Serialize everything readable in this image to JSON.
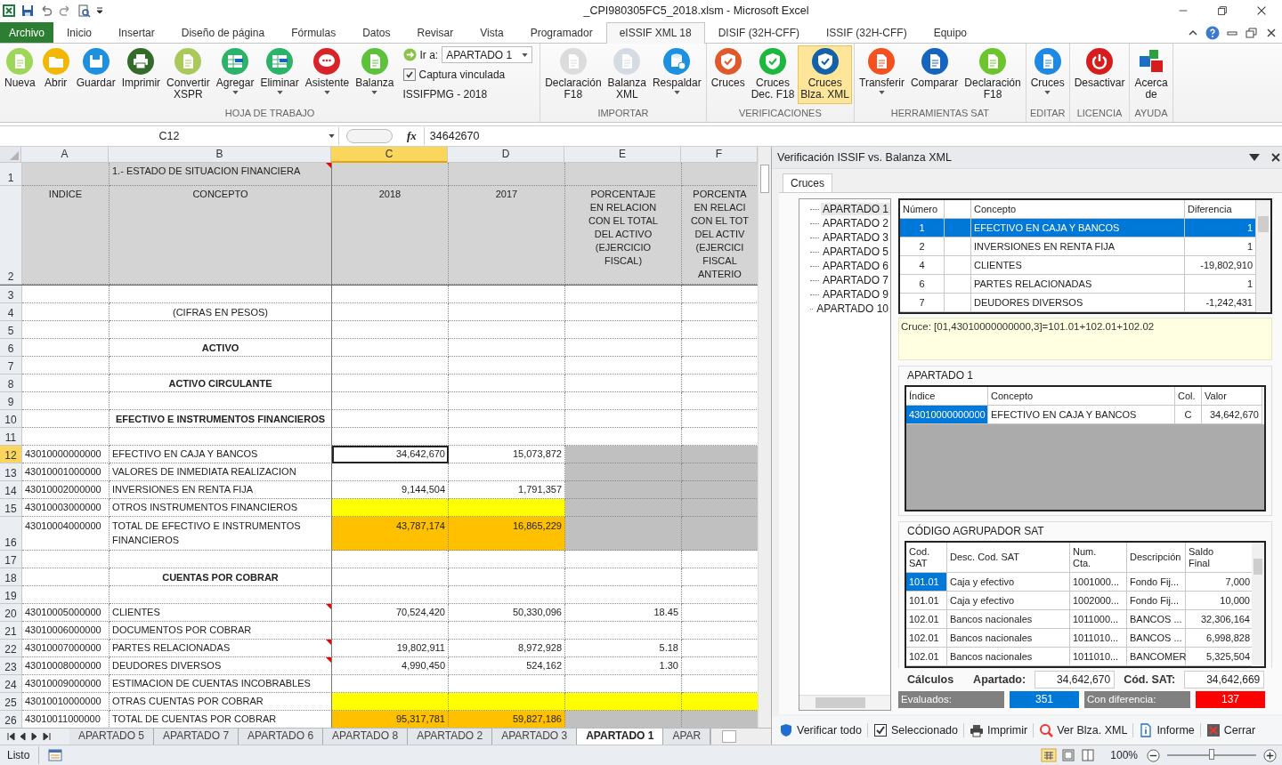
{
  "window": {
    "title": "_CPI980305FC5_2018.xlsm  -  Microsoft Excel"
  },
  "ribbon_tabs": [
    {
      "label": "Archivo",
      "kind": "file",
      "selected": false
    },
    {
      "label": "Inicio",
      "kind": "tab",
      "selected": false
    },
    {
      "label": "Insertar",
      "kind": "tab",
      "selected": false
    },
    {
      "label": "Diseño de página",
      "kind": "tab",
      "selected": false
    },
    {
      "label": "Fórmulas",
      "kind": "tab",
      "selected": false
    },
    {
      "label": "Datos",
      "kind": "tab",
      "selected": false
    },
    {
      "label": "Revisar",
      "kind": "tab",
      "selected": false
    },
    {
      "label": "Vista",
      "kind": "tab",
      "selected": false
    },
    {
      "label": "Programador",
      "kind": "tab",
      "selected": false
    },
    {
      "label": "eISSIF XML 18",
      "kind": "tab",
      "selected": true
    },
    {
      "label": "DISIF (32H-CFF)",
      "kind": "tab",
      "selected": false
    },
    {
      "label": "ISSIF (32H-CFF)",
      "kind": "tab",
      "selected": false
    },
    {
      "label": "Equipo",
      "kind": "tab",
      "selected": false
    }
  ],
  "ribbon": {
    "groups": [
      {
        "label": "HOJA DE TRABAJO",
        "items": [
          {
            "label": "Nueva",
            "kind": "page",
            "color": "#9ed65a",
            "dropdown": false,
            "selected": false
          },
          {
            "label": "Abrir",
            "kind": "folder",
            "color": "#f2b705",
            "dropdown": false,
            "selected": false
          },
          {
            "label": "Guardar",
            "kind": "disk",
            "color": "#1e90e0",
            "dropdown": false,
            "selected": false
          },
          {
            "label": "Imprimir",
            "kind": "printer",
            "color": "#356b2a",
            "dropdown": false,
            "selected": false
          },
          {
            "label": "Convertir\nXSPR",
            "kind": "page",
            "color": "#a9c95b",
            "dropdown": false,
            "selected": false
          },
          {
            "label": "Agregar",
            "kind": "grid",
            "color": "#2bb36a",
            "dropdown": true,
            "selected": false
          },
          {
            "label": "Eliminar",
            "kind": "grid",
            "color": "#2bb36a",
            "dropdown": true,
            "selected": false
          },
          {
            "label": "Asistente",
            "kind": "chat",
            "color": "#d8232a",
            "dropdown": true,
            "selected": false
          },
          {
            "label": "Balanza",
            "kind": "page",
            "color": "#5cc23c",
            "dropdown": true,
            "selected": false
          }
        ],
        "controls": {
          "goto_label": "Ir a:",
          "goto_value": "APARTADO 1",
          "checkbox_label": "Captura vinculada",
          "checked": true,
          "note": "ISSIFPMG - 2018"
        }
      },
      {
        "label": "IMPORTAR",
        "items": [
          {
            "label": "Declaración\nF18",
            "kind": "page",
            "color": "#dcdcdc",
            "dropdown": false,
            "selected": false
          },
          {
            "label": "Balanza\nXML",
            "kind": "page",
            "color": "#d4dbe3",
            "dropdown": false,
            "selected": false
          },
          {
            "label": "Respaldar",
            "kind": "db",
            "color": "#1e90e0",
            "dropdown": true,
            "selected": false
          }
        ]
      },
      {
        "label": "VERIFICACIONES",
        "items": [
          {
            "label": "Cruces",
            "kind": "shield",
            "color": "#e0592b",
            "dropdown": false,
            "selected": false
          },
          {
            "label": "Cruces\nDec. F18",
            "kind": "shield",
            "color": "#1cb83e",
            "dropdown": false,
            "selected": false
          },
          {
            "label": "Cruces\nBlza. XML",
            "kind": "shield",
            "color": "#1461a8",
            "dropdown": false,
            "selected": true
          }
        ]
      },
      {
        "label": "HERRAMIENTAS SAT",
        "items": [
          {
            "label": "Transferir",
            "kind": "page",
            "color": "#f4511e",
            "dropdown": true,
            "selected": false
          },
          {
            "label": "Comparar",
            "kind": "page",
            "color": "#1565c0",
            "dropdown": false,
            "selected": false
          },
          {
            "label": "Declaración\nF18",
            "kind": "page",
            "color": "#6cc52b",
            "dropdown": false,
            "selected": false
          }
        ]
      },
      {
        "label": "EDITAR",
        "items": [
          {
            "label": "Cruces",
            "kind": "page",
            "color": "#1e88e5",
            "dropdown": true,
            "selected": false
          }
        ]
      },
      {
        "label": "LICENCIA",
        "items": [
          {
            "label": "Desactivar",
            "kind": "power",
            "color": "#d81b1b",
            "dropdown": false,
            "selected": false
          }
        ]
      },
      {
        "label": "AYUDA",
        "items": [
          {
            "label": "Acerca\nde",
            "kind": "blocks",
            "dropdown": false,
            "selected": false
          }
        ]
      }
    ]
  },
  "formula_bar": {
    "name_box": "C12",
    "function_symbol": "fx",
    "value": "34642670"
  },
  "sheet": {
    "columns": [
      {
        "label": "A",
        "selected": false
      },
      {
        "label": "B",
        "selected": false
      },
      {
        "label": "C",
        "selected": true
      },
      {
        "label": "D",
        "selected": false
      },
      {
        "label": "E",
        "selected": false
      },
      {
        "label": "F",
        "selected": false
      }
    ],
    "rows": [
      {
        "n": "1",
        "kind": "title",
        "cells": [
          {
            "color": "#d4d4d4"
          },
          {
            "text": "1.- ESTADO DE SITUACION FINANCIERA",
            "color": "#d4d4d4",
            "comment": true
          },
          {
            "color": "#d4d4d4"
          },
          {
            "color": "#d4d4d4"
          },
          {
            "color": "#d4d4d4"
          },
          {
            "color": "#d4d4d4"
          }
        ]
      },
      {
        "n": "2",
        "kind": "header",
        "cells": [
          {
            "text": "INDICE",
            "color": "#d4d4d4"
          },
          {
            "text": "CONCEPTO",
            "color": "#d4d4d4"
          },
          {
            "text": "2018",
            "color": "#d4d4d4"
          },
          {
            "text": "2017",
            "color": "#d4d4d4"
          },
          {
            "text": "PORCENTAJE\nEN RELACION\nCON EL TOTAL\nDEL ACTIVO\n(EJERCICIO\nFISCAL)",
            "color": "#d4d4d4"
          },
          {
            "text": "PORCENTA\nEN RELACI\nCON EL TOT\nDEL ACTIV\n(EJERCICI\nFISCAL\nANTERIO",
            "color": "#d4d4d4"
          }
        ]
      },
      {
        "n": "3",
        "kind": "data",
        "cells": [
          {},
          {},
          {},
          {},
          {},
          {}
        ]
      },
      {
        "n": "4",
        "kind": "note",
        "cells": [
          {},
          {
            "text": "(CIFRAS EN PESOS)"
          },
          {},
          {},
          {},
          {}
        ]
      },
      {
        "n": "5",
        "kind": "data",
        "cells": [
          {},
          {},
          {},
          {},
          {},
          {}
        ]
      },
      {
        "n": "6",
        "kind": "heading",
        "cells": [
          {},
          {
            "text": "ACTIVO"
          },
          {},
          {},
          {},
          {}
        ]
      },
      {
        "n": "7",
        "kind": "data",
        "cells": [
          {},
          {},
          {},
          {},
          {},
          {}
        ]
      },
      {
        "n": "8",
        "kind": "heading",
        "cells": [
          {},
          {
            "text": "ACTIVO CIRCULANTE"
          },
          {},
          {},
          {},
          {}
        ]
      },
      {
        "n": "9",
        "kind": "data",
        "cells": [
          {},
          {},
          {},
          {},
          {},
          {}
        ]
      },
      {
        "n": "10",
        "kind": "heading",
        "cells": [
          {},
          {
            "text": "EFECTIVO E INSTRUMENTOS FINANCIEROS"
          },
          {},
          {},
          {},
          {}
        ]
      },
      {
        "n": "11",
        "kind": "data",
        "cells": [
          {},
          {},
          {},
          {},
          {},
          {}
        ]
      },
      {
        "n": "12",
        "kind": "data",
        "cells": [
          {
            "text": "43010000000000"
          },
          {
            "text": "EFECTIVO EN CAJA Y BANCOS"
          },
          {
            "text": "34,642,670",
            "active": true
          },
          {
            "text": "15,073,872"
          },
          {
            "color": "#c0c0c0"
          },
          {
            "color": "#c0c0c0"
          }
        ]
      },
      {
        "n": "13",
        "kind": "data",
        "cells": [
          {
            "text": "43010001000000"
          },
          {
            "text": "VALORES DE INMEDIATA REALIZACION"
          },
          {},
          {},
          {
            "color": "#c0c0c0"
          },
          {
            "color": "#c0c0c0"
          }
        ]
      },
      {
        "n": "14",
        "kind": "data",
        "cells": [
          {
            "text": "43010002000000"
          },
          {
            "text": "INVERSIONES EN RENTA FIJA"
          },
          {
            "text": "9,144,504"
          },
          {
            "text": "1,791,357"
          },
          {
            "color": "#c0c0c0"
          },
          {
            "color": "#c0c0c0"
          }
        ]
      },
      {
        "n": "15",
        "kind": "data",
        "cells": [
          {
            "text": "43010003000000"
          },
          {
            "text": "OTROS INSTRUMENTOS FINANCIEROS"
          },
          {
            "color": "#ffff00"
          },
          {
            "color": "#ffff00"
          },
          {
            "color": "#c0c0c0"
          },
          {
            "color": "#c0c0c0"
          }
        ]
      },
      {
        "n": "16",
        "kind": "tall",
        "cells": [
          {
            "text": "43010004000000"
          },
          {
            "text": "TOTAL DE EFECTIVO E INSTRUMENTOS FINANCIEROS"
          },
          {
            "text": "43,787,174",
            "color": "#ffc000"
          },
          {
            "text": "16,865,229",
            "color": "#ffc000"
          },
          {
            "color": "#c0c0c0"
          },
          {
            "color": "#c0c0c0"
          }
        ]
      },
      {
        "n": "17",
        "kind": "data",
        "cells": [
          {},
          {},
          {},
          {},
          {},
          {}
        ]
      },
      {
        "n": "18",
        "kind": "heading",
        "cells": [
          {},
          {
            "text": "CUENTAS POR COBRAR"
          },
          {},
          {},
          {},
          {}
        ]
      },
      {
        "n": "19",
        "kind": "data",
        "cells": [
          {},
          {},
          {},
          {},
          {},
          {}
        ]
      },
      {
        "n": "20",
        "kind": "data",
        "cells": [
          {
            "text": "43010005000000"
          },
          {
            "text": "CLIENTES",
            "comment": true
          },
          {
            "text": "70,524,420"
          },
          {
            "text": "50,330,096"
          },
          {
            "text": "18.45"
          },
          {}
        ]
      },
      {
        "n": "21",
        "kind": "data",
        "cells": [
          {
            "text": "43010006000000"
          },
          {
            "text": "DOCUMENTOS POR COBRAR"
          },
          {},
          {},
          {},
          {}
        ]
      },
      {
        "n": "22",
        "kind": "data",
        "cells": [
          {
            "text": "43010007000000"
          },
          {
            "text": "PARTES RELACIONADAS",
            "comment": true
          },
          {
            "text": "19,802,911"
          },
          {
            "text": "8,972,928"
          },
          {
            "text": "5.18"
          },
          {}
        ]
      },
      {
        "n": "23",
        "kind": "data",
        "cells": [
          {
            "text": "43010008000000"
          },
          {
            "text": "DEUDORES DIVERSOS",
            "comment": true
          },
          {
            "text": "4,990,450"
          },
          {
            "text": "524,162"
          },
          {
            "text": "1.30"
          },
          {}
        ]
      },
      {
        "n": "24",
        "kind": "data",
        "cells": [
          {
            "text": "43010009000000"
          },
          {
            "text": "ESTIMACION DE CUENTAS INCOBRABLES"
          },
          {},
          {},
          {},
          {}
        ]
      },
      {
        "n": "25",
        "kind": "data",
        "cells": [
          {
            "text": "43010010000000"
          },
          {
            "text": "OTRAS CUENTAS POR COBRAR"
          },
          {
            "color": "#ffff00"
          },
          {
            "color": "#ffff00"
          },
          {
            "color": "#ffff00"
          },
          {
            "color": "#ffff00"
          }
        ]
      },
      {
        "n": "26",
        "kind": "data",
        "cells": [
          {
            "text": "43010011000000"
          },
          {
            "text": "TOTAL DE CUENTAS POR COBRAR"
          },
          {
            "text": "95,317,781",
            "color": "#ffc000"
          },
          {
            "text": "59,827,186",
            "color": "#ffc000"
          },
          {
            "color": "#c0c0c0"
          },
          {
            "color": "#c0c0c0"
          }
        ]
      }
    ],
    "tabs": [
      {
        "label": "APARTADO 5",
        "selected": false
      },
      {
        "label": "APARTADO 7",
        "selected": false
      },
      {
        "label": "APARTADO 6",
        "selected": false
      },
      {
        "label": "APARTADO 8",
        "selected": false
      },
      {
        "label": "APARTADO 2",
        "selected": false
      },
      {
        "label": "APARTADO 3",
        "selected": false
      },
      {
        "label": "APARTADO 1",
        "selected": true
      },
      {
        "label": "APAR",
        "selected": false
      }
    ]
  },
  "task_pane": {
    "title": "Verificación ISSIF vs. Balanza XML",
    "tabs": [
      {
        "label": "Cruces",
        "selected": true
      }
    ],
    "tree": [
      {
        "label": "APARTADO 1",
        "selected": true
      },
      {
        "label": "APARTADO 2",
        "selected": false
      },
      {
        "label": "APARTADO 3",
        "selected": false
      },
      {
        "label": "APARTADO 5",
        "selected": false
      },
      {
        "label": "APARTADO 6",
        "selected": false
      },
      {
        "label": "APARTADO 7",
        "selected": false
      },
      {
        "label": "APARTADO 9",
        "selected": false
      },
      {
        "label": "APARTADO 10",
        "selected": false
      }
    ],
    "checks": {
      "columns": [
        "Número",
        "Concepto",
        "Diferencia"
      ],
      "rows": [
        {
          "number": "1",
          "concept": "EFECTIVO EN CAJA Y BANCOS",
          "difference": "1",
          "selected": true
        },
        {
          "number": "2",
          "concept": "INVERSIONES EN RENTA FIJA",
          "difference": "1",
          "selected": false
        },
        {
          "number": "4",
          "concept": "CLIENTES",
          "difference": "-19,802,910",
          "selected": false
        },
        {
          "number": "6",
          "concept": "PARTES RELACIONADAS",
          "difference": "1",
          "selected": false
        },
        {
          "number": "7",
          "concept": "DEUDORES DIVERSOS",
          "difference": "-1,242,431",
          "selected": false
        }
      ]
    },
    "formula_note": "Cruce: [01,43010000000000,3]=101.01+102.01+102.02",
    "section": {
      "title": "APARTADO 1",
      "columns": [
        "Índice",
        "Concepto",
        "Col.",
        "Valor"
      ],
      "rows": [
        {
          "index": "43010000000000",
          "concept": "EFECTIVO EN CAJA Y BANCOS",
          "col": "C",
          "value": "34,642,670",
          "selected": true
        }
      ]
    },
    "sat": {
      "title": "CÓDIGO AGRUPADOR SAT",
      "columns": [
        "Cod.\nSAT",
        "Desc. Cod. SAT",
        "Num.\nCta.",
        "Descripción",
        "Saldo\nFinal"
      ],
      "rows": [
        {
          "code": "101.01",
          "desc": "Caja y efectivo",
          "account": "1001000...",
          "description": "Fondo Fij...",
          "balance": "7,000",
          "selected": true
        },
        {
          "code": "101.01",
          "desc": "Caja y efectivo",
          "account": "1002000...",
          "description": "Fondo Fij...",
          "balance": "10,000",
          "selected": false
        },
        {
          "code": "102.01",
          "desc": "Bancos nacionales",
          "account": "1011000...",
          "description": "BANCOS ...",
          "balance": "32,306,164",
          "selected": false
        },
        {
          "code": "102.01",
          "desc": "Bancos nacionales",
          "account": "1011010...",
          "description": "BANCOS ...",
          "balance": "6,998,828",
          "selected": false
        },
        {
          "code": "102.01",
          "desc": "Bancos nacionales",
          "account": "1011010...",
          "description": "BANCOMER",
          "balance": "5,325,504",
          "selected": false
        }
      ]
    },
    "calc": {
      "label": "Cálculos",
      "section_label": "Apartado:",
      "section_value": "34,642,670",
      "sat_label": "Cód. SAT:",
      "sat_value": "34,642,669"
    },
    "stats": [
      {
        "label": "Evaluados:",
        "value": "351",
        "color": "#0078d7"
      },
      {
        "label": "Con diferencia:",
        "value": "137",
        "color": "#ff0000"
      }
    ],
    "toolbar": [
      {
        "label": "Verificar todo",
        "kind": "verify"
      },
      {
        "label": "Seleccionado",
        "kind": "check"
      },
      {
        "label": "Imprimir",
        "kind": "print"
      },
      {
        "label": "Ver Blza. XML",
        "kind": "view"
      },
      {
        "label": "Informe",
        "kind": "report"
      },
      {
        "label": "Cerrar",
        "kind": "close"
      }
    ]
  },
  "status_bar": {
    "text": "Listo",
    "zoom": "100%",
    "level": 0.5
  }
}
